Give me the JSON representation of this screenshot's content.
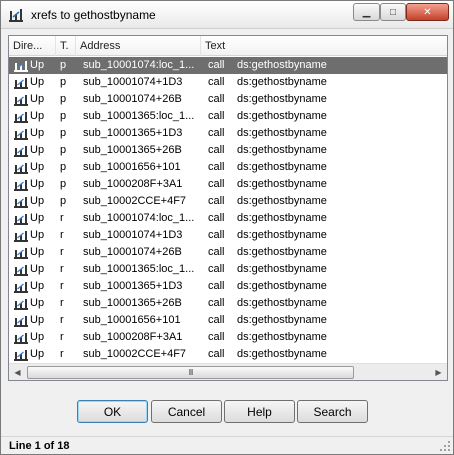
{
  "window": {
    "title": "xrefs to gethostbyname",
    "title_icon": "xref-icon",
    "controls": {
      "minimize": "minimize-icon",
      "maximize": "maximize-icon",
      "close": "close-icon"
    }
  },
  "list": {
    "columns": {
      "direction": "Dire...",
      "type": "T.",
      "address": "Address",
      "text": "Text"
    },
    "rows": [
      {
        "direction": "Up",
        "type": "p",
        "address": "sub_10001074:loc_1...",
        "op": "call",
        "target": "ds:gethostbyname"
      },
      {
        "direction": "Up",
        "type": "p",
        "address": "sub_10001074+1D3",
        "op": "call",
        "target": "ds:gethostbyname"
      },
      {
        "direction": "Up",
        "type": "p",
        "address": "sub_10001074+26B",
        "op": "call",
        "target": "ds:gethostbyname"
      },
      {
        "direction": "Up",
        "type": "p",
        "address": "sub_10001365:loc_1...",
        "op": "call",
        "target": "ds:gethostbyname"
      },
      {
        "direction": "Up",
        "type": "p",
        "address": "sub_10001365+1D3",
        "op": "call",
        "target": "ds:gethostbyname"
      },
      {
        "direction": "Up",
        "type": "p",
        "address": "sub_10001365+26B",
        "op": "call",
        "target": "ds:gethostbyname"
      },
      {
        "direction": "Up",
        "type": "p",
        "address": "sub_10001656+101",
        "op": "call",
        "target": "ds:gethostbyname"
      },
      {
        "direction": "Up",
        "type": "p",
        "address": "sub_1000208F+3A1",
        "op": "call",
        "target": "ds:gethostbyname"
      },
      {
        "direction": "Up",
        "type": "p",
        "address": "sub_10002CCE+4F7",
        "op": "call",
        "target": "ds:gethostbyname"
      },
      {
        "direction": "Up",
        "type": "r",
        "address": "sub_10001074:loc_1...",
        "op": "call",
        "target": "ds:gethostbyname"
      },
      {
        "direction": "Up",
        "type": "r",
        "address": "sub_10001074+1D3",
        "op": "call",
        "target": "ds:gethostbyname"
      },
      {
        "direction": "Up",
        "type": "r",
        "address": "sub_10001074+26B",
        "op": "call",
        "target": "ds:gethostbyname"
      },
      {
        "direction": "Up",
        "type": "r",
        "address": "sub_10001365:loc_1...",
        "op": "call",
        "target": "ds:gethostbyname"
      },
      {
        "direction": "Up",
        "type": "r",
        "address": "sub_10001365+1D3",
        "op": "call",
        "target": "ds:gethostbyname"
      },
      {
        "direction": "Up",
        "type": "r",
        "address": "sub_10001365+26B",
        "op": "call",
        "target": "ds:gethostbyname"
      },
      {
        "direction": "Up",
        "type": "r",
        "address": "sub_10001656+101",
        "op": "call",
        "target": "ds:gethostbyname"
      },
      {
        "direction": "Up",
        "type": "r",
        "address": "sub_1000208F+3A1",
        "op": "call",
        "target": "ds:gethostbyname"
      },
      {
        "direction": "Up",
        "type": "r",
        "address": "sub_10002CCE+4F7",
        "op": "call",
        "target": "ds:gethostbyname"
      }
    ],
    "selected_index": 0,
    "scrollbar": {
      "grip": "III"
    }
  },
  "buttons": {
    "ok": "OK",
    "cancel": "Cancel",
    "help": "Help",
    "search": "Search"
  },
  "status": {
    "text": "Line 1 of 18"
  },
  "colors": {
    "selection": "#6e6e6e",
    "close_button": "#c2412b"
  }
}
